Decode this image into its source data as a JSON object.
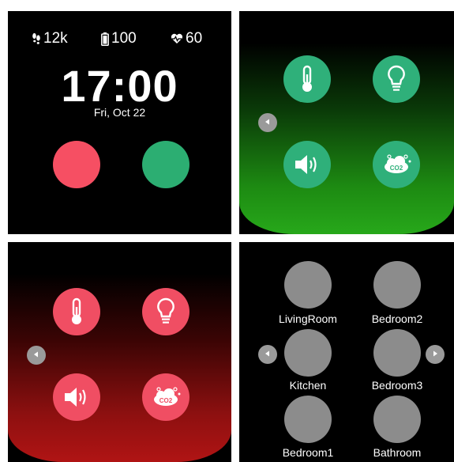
{
  "watchface": {
    "steps": "12k",
    "battery": "100",
    "heart_rate": "60",
    "time": "17:00",
    "date": "Fri, Oct 22",
    "colors": {
      "left_button": "#f64f63",
      "right_button": "#2cae72"
    }
  },
  "controls_green": {
    "theme_color": "#2fb07a",
    "tiles": [
      {
        "icon": "thermometer-icon"
      },
      {
        "icon": "lightbulb-icon"
      },
      {
        "icon": "speaker-icon"
      },
      {
        "icon": "co2-cloud-icon",
        "text": "CO2"
      }
    ],
    "nav": "chevron-left-icon"
  },
  "controls_red": {
    "theme_color": "#f04e63",
    "tiles": [
      {
        "icon": "thermometer-icon"
      },
      {
        "icon": "lightbulb-icon"
      },
      {
        "icon": "speaker-icon"
      },
      {
        "icon": "co2-cloud-icon",
        "text": "CO2"
      }
    ],
    "nav": "chevron-left-icon"
  },
  "rooms": {
    "items": [
      "LivingRoom",
      "Bedroom2",
      "Kitchen",
      "Bedroom3",
      "Bedroom1",
      "Bathroom"
    ],
    "nav_prev": "chevron-left-icon",
    "nav_next": "chevron-right-icon"
  }
}
